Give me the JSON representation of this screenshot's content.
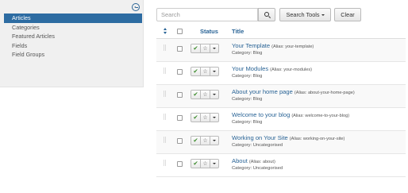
{
  "sidebar": {
    "items": [
      {
        "label": "Articles",
        "active": true
      },
      {
        "label": "Categories",
        "active": false
      },
      {
        "label": "Featured Articles",
        "active": false
      },
      {
        "label": "Fields",
        "active": false
      },
      {
        "label": "Field Groups",
        "active": false
      }
    ]
  },
  "toolbar": {
    "search_placeholder": "Search",
    "search_tools_label": "Search Tools",
    "clear_label": "Clear"
  },
  "table": {
    "headers": {
      "status": "Status",
      "title": "Title"
    },
    "rows": [
      {
        "title": "Your Template",
        "alias": "(Alias: your-template)",
        "category": "Category: Blog"
      },
      {
        "title": "Your Modules",
        "alias": "(Alias: your-modules)",
        "category": "Category: Blog"
      },
      {
        "title": "About your home page",
        "alias": "(Alias: about-your-home-page)",
        "category": "Category: Blog"
      },
      {
        "title": "Welcome to your blog",
        "alias": "(Alias: welcome-to-your-blog)",
        "category": "Category: Blog"
      },
      {
        "title": "Working on Your Site",
        "alias": "(Alias: working-on-your-site)",
        "category": "Category: Uncategorised"
      },
      {
        "title": "About",
        "alias": "(Alias: about)",
        "category": "Category: Uncategorised"
      }
    ]
  },
  "icons": {
    "sidebar_toggle": "arrow-left-circle-icon",
    "search": "search-icon",
    "ordering": "sort-icon",
    "drag": "drag-handle-icon",
    "published": "check-icon",
    "featured": "star-icon",
    "actions": "caret-down-icon"
  },
  "colors": {
    "sidebar_active_bg": "#2d6ca2",
    "link": "#2a6496",
    "published_check": "#3a8a2a"
  }
}
